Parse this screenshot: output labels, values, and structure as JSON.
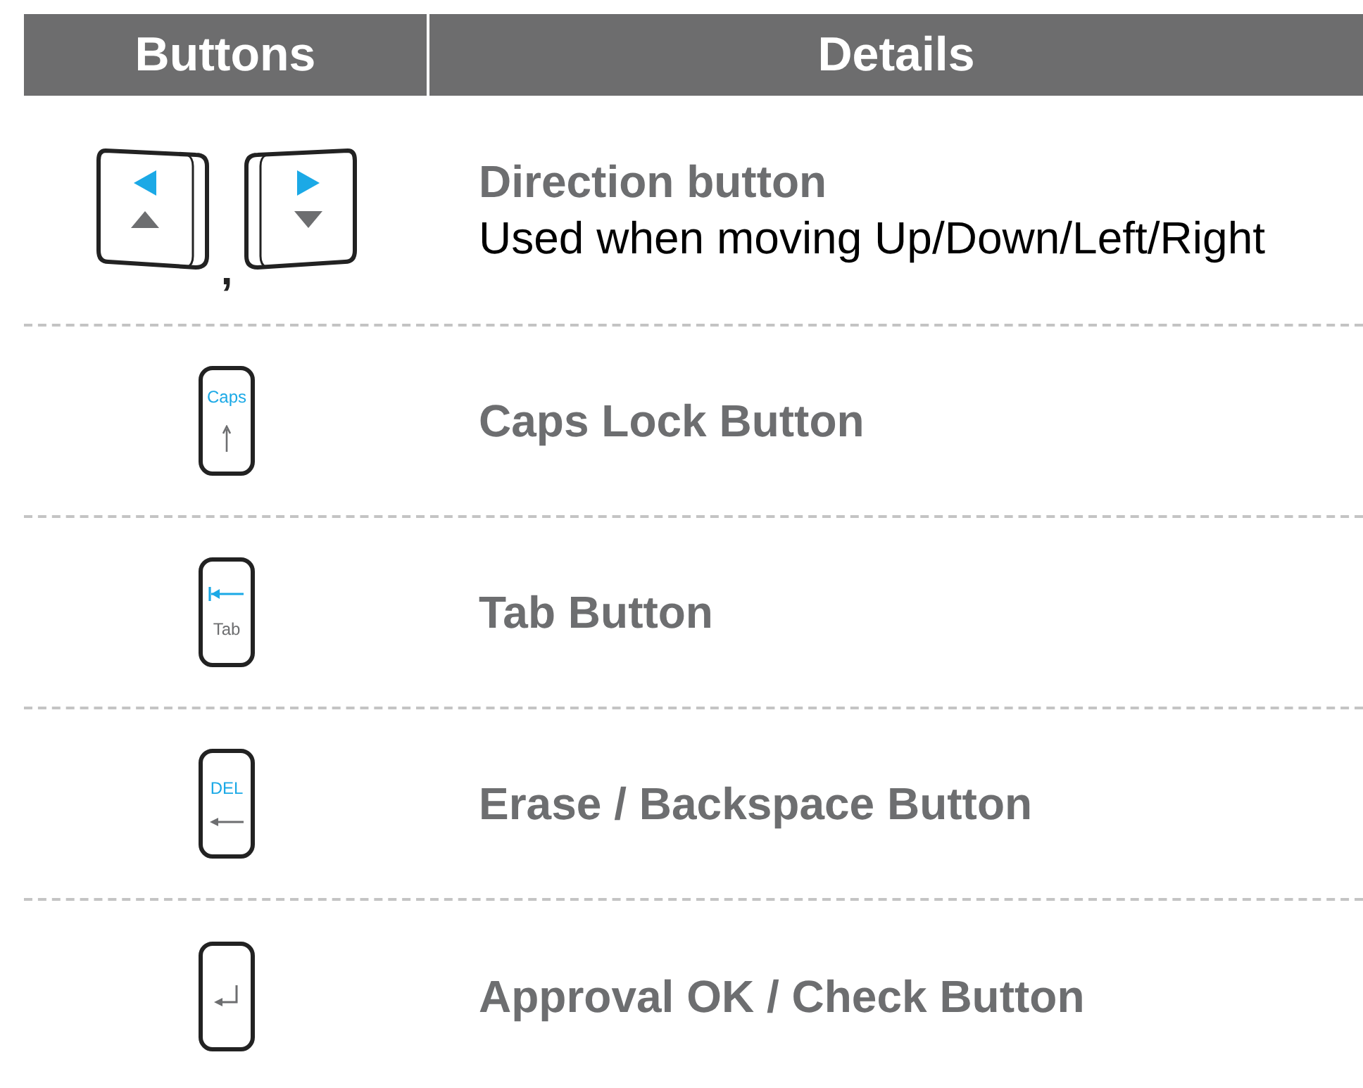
{
  "header": {
    "columns": [
      "Buttons",
      "Details"
    ]
  },
  "rows": [
    {
      "kind": "direction",
      "separator": ",",
      "title": "Direction button",
      "description": "Used when moving Up/Down/Left/Right"
    },
    {
      "kind": "caps",
      "key_label": "Caps",
      "title": "Caps Lock Button"
    },
    {
      "kind": "tab",
      "key_label": "Tab",
      "title": "Tab Button"
    },
    {
      "kind": "del",
      "key_label": "DEL",
      "title": "Erase / Backspace Button"
    },
    {
      "kind": "enter",
      "title": "Approval OK / Check Button"
    }
  ]
}
